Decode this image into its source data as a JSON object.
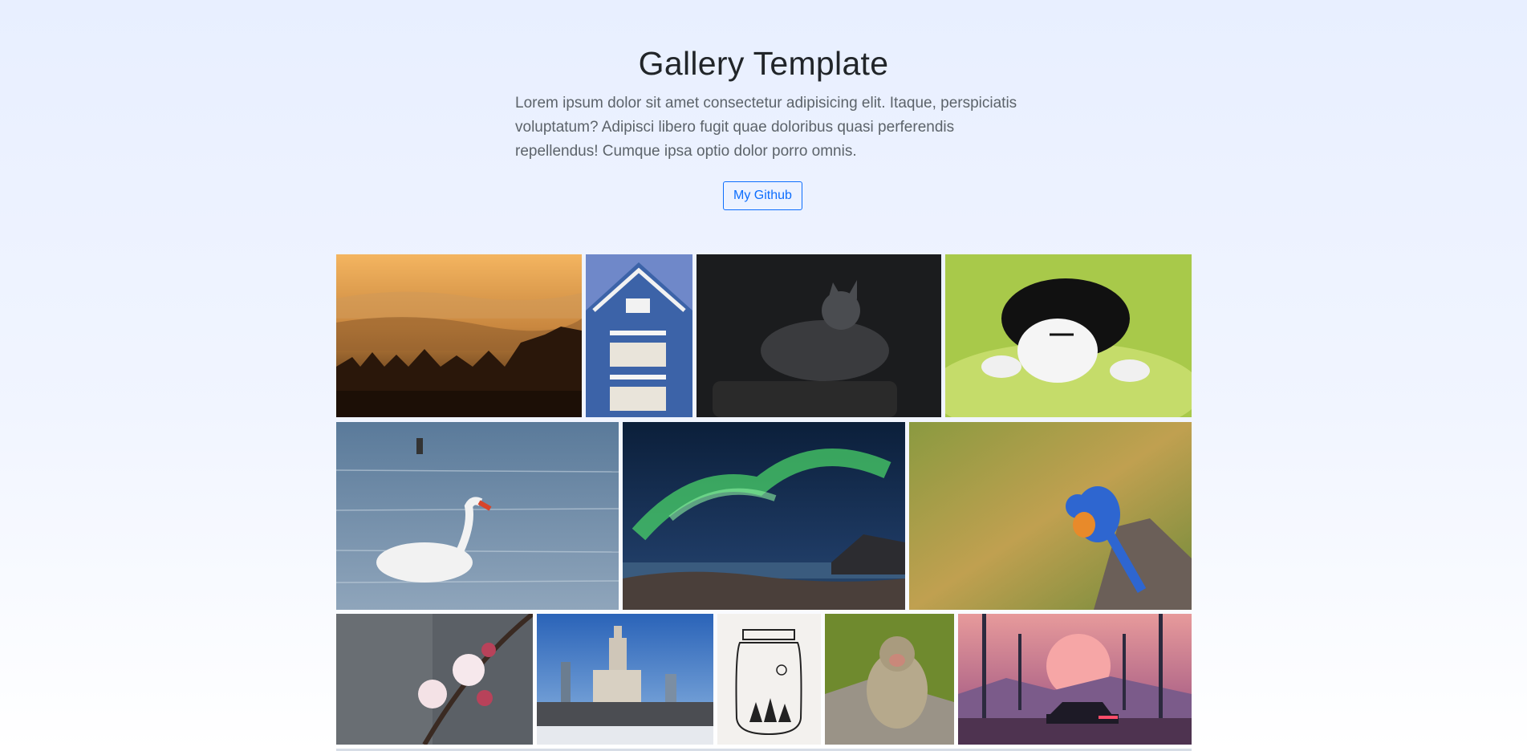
{
  "hero": {
    "title": "Gallery Template",
    "lead": "Lorem ipsum dolor sit amet consectetur adipisicing elit. Itaque, perspiciatis voluptatum? Adipisci libero fugit quae doloribus quasi perferendis repellendus! Cumque ipsa optio dolor porro omnis.",
    "button_label": "My Github"
  },
  "colors": {
    "accent": "#0d6efd",
    "text": "#212529",
    "muted": "#5c636a"
  },
  "gallery": [
    {
      "name": "misty-sunrise-hills-photo"
    },
    {
      "name": "blue-house-balconies-photo"
    },
    {
      "name": "grey-cat-in-dark-photo"
    },
    {
      "name": "sleeping-kitten-photo"
    },
    {
      "name": "swan-on-lake-photo"
    },
    {
      "name": "northern-lights-photo"
    },
    {
      "name": "bluebird-on-branch-photo"
    },
    {
      "name": "cherry-blossom-photo"
    },
    {
      "name": "city-skyline-tower-photo"
    },
    {
      "name": "jar-sketch-illustration"
    },
    {
      "name": "baboon-photo"
    },
    {
      "name": "synthwave-car-sunset-illustration"
    }
  ]
}
